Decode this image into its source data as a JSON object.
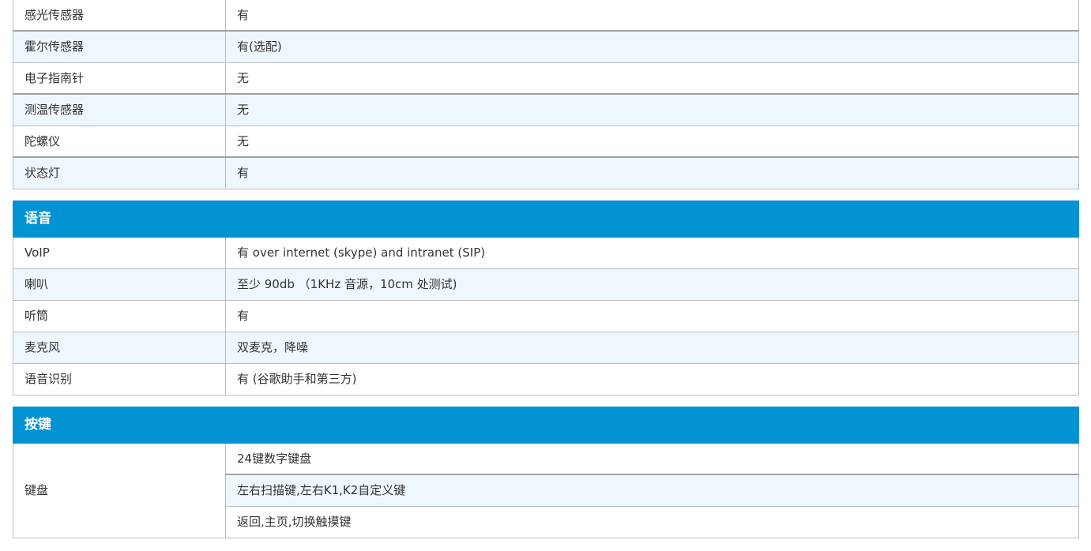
{
  "sensors": {
    "rows": [
      {
        "label": "感光传感器",
        "value": "有"
      },
      {
        "label": "霍尔传感器",
        "value": "有(选配)"
      },
      {
        "label": "电子指南针",
        "value": "无"
      },
      {
        "label": "测温传感器",
        "value": "无"
      },
      {
        "label": "陀螺仪",
        "value": "无"
      },
      {
        "label": "状态灯",
        "value": "有"
      }
    ]
  },
  "voice": {
    "title": "语音",
    "rows": [
      {
        "label": "VoIP",
        "value": "有 over internet (skype) and intranet (SIP)"
      },
      {
        "label": "喇叭",
        "value": "至少 90db （1KHz 音源，10cm 处测试)"
      },
      {
        "label": "听筒",
        "value": "有"
      },
      {
        "label": "麦克风",
        "value": "双麦克，降噪"
      },
      {
        "label": "语音识别",
        "value": "有 (谷歌助手和第三方)"
      }
    ]
  },
  "keys": {
    "title": "按键",
    "keyboard_label": "键盘",
    "keyboard_values": [
      "24键数字键盘",
      "左右扫描键,左右K1,K2自定义键",
      "返回,主页,切换触摸键"
    ]
  }
}
